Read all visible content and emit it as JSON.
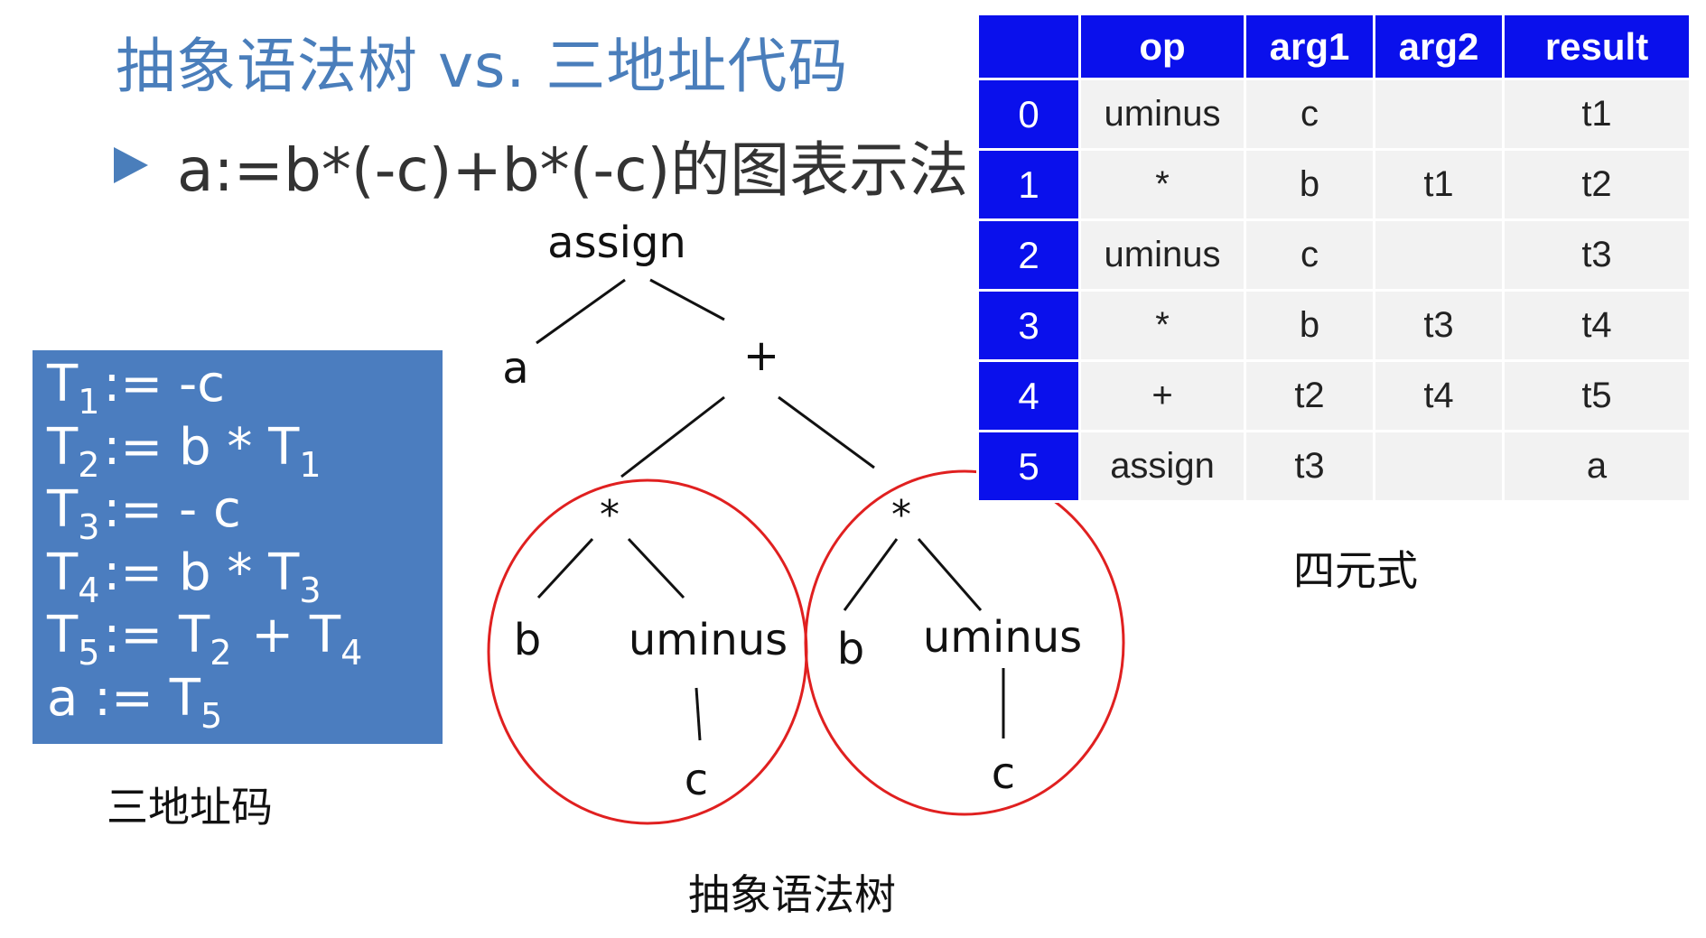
{
  "slide": {
    "title": "抽象语法树 vs. 三地址代码",
    "bullet": "a:=b*(-c)+b*(-c)的图表示法"
  },
  "three_address_code": {
    "lines": [
      {
        "lhs": "T",
        "lhs_sub": "1",
        "rhs_parts": [
          {
            "t": ":= -c"
          }
        ]
      },
      {
        "lhs": "T",
        "lhs_sub": "2",
        "rhs_parts": [
          {
            "t": ":= b * T"
          },
          {
            "sub": "1"
          }
        ]
      },
      {
        "lhs": "T",
        "lhs_sub": "3",
        "rhs_parts": [
          {
            "t": ":= - c"
          }
        ]
      },
      {
        "lhs": "T",
        "lhs_sub": "4",
        "rhs_parts": [
          {
            "t": ":= b * T"
          },
          {
            "sub": "3"
          }
        ]
      },
      {
        "lhs": "T",
        "lhs_sub": "5",
        "rhs_parts": [
          {
            "t": ":= T"
          },
          {
            "sub": "2"
          },
          {
            "t": " + T"
          },
          {
            "sub": "4"
          }
        ]
      },
      {
        "lhs": "a",
        "lhs_sub": "",
        "rhs_parts": [
          {
            "t": ":= T"
          },
          {
            "sub": "5"
          }
        ]
      }
    ],
    "caption": "三地址码"
  },
  "syntax_tree": {
    "caption": "抽象语法树",
    "root": "assign",
    "left": "a",
    "plus": "+",
    "left_sub": {
      "op": "*",
      "b": "b",
      "uminus": "uminus",
      "c": "c"
    },
    "right_sub": {
      "op": "*",
      "b": "b",
      "uminus": "uminus",
      "c": "c"
    },
    "circle_color": "#e02020"
  },
  "quadruples": {
    "headers": [
      "",
      "op",
      "arg1",
      "arg2",
      "result"
    ],
    "rows": [
      {
        "index": "0",
        "op": "uminus",
        "arg1": "c",
        "arg2": "",
        "result": "t1"
      },
      {
        "index": "1",
        "op": "*",
        "arg1": "b",
        "arg2": "t1",
        "result": "t2"
      },
      {
        "index": "2",
        "op": "uminus",
        "arg1": "c",
        "arg2": "",
        "result": "t3"
      },
      {
        "index": "3",
        "op": "*",
        "arg1": "b",
        "arg2": "t3",
        "result": "t4"
      },
      {
        "index": "4",
        "op": "+",
        "arg1": "t2",
        "arg2": "t4",
        "result": "t5"
      },
      {
        "index": "5",
        "op": "assign",
        "arg1": "t3",
        "arg2": "",
        "result": "a"
      }
    ],
    "caption": "四元式",
    "header_color": "#0a10ec"
  }
}
